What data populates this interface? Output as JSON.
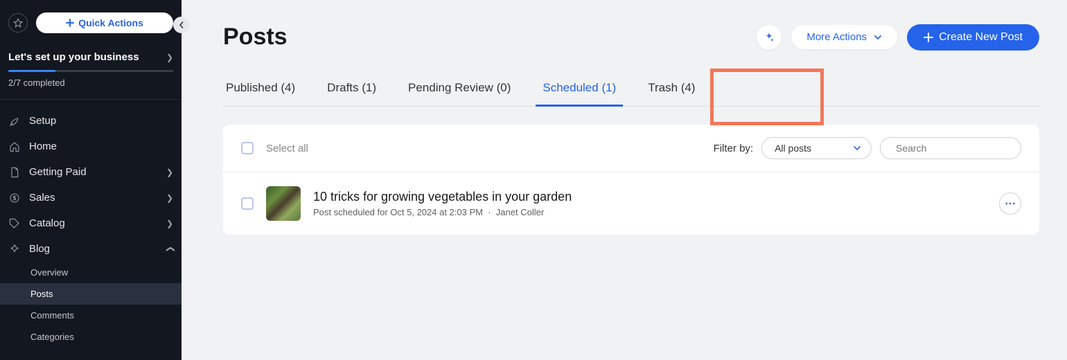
{
  "sidebar": {
    "quick_actions_label": "Quick Actions",
    "setup_title": "Let's set up your business",
    "progress_completed": 2,
    "progress_total": 7,
    "progress_text": "2/7 completed",
    "nav": [
      {
        "label": "Setup",
        "has_chevron": false
      },
      {
        "label": "Home",
        "has_chevron": false
      },
      {
        "label": "Getting Paid",
        "has_chevron": true
      },
      {
        "label": "Sales",
        "has_chevron": true
      },
      {
        "label": "Catalog",
        "has_chevron": true
      },
      {
        "label": "Blog",
        "has_chevron": true,
        "expanded": true
      }
    ],
    "blog_sub": [
      {
        "label": "Overview",
        "active": false
      },
      {
        "label": "Posts",
        "active": true
      },
      {
        "label": "Comments",
        "active": false
      },
      {
        "label": "Categories",
        "active": false
      }
    ]
  },
  "header": {
    "title": "Posts",
    "more_actions_label": "More Actions",
    "create_label": "Create New Post"
  },
  "tabs": [
    {
      "label": "Published (4)",
      "active": false
    },
    {
      "label": "Drafts (1)",
      "active": false
    },
    {
      "label": "Pending Review (0)",
      "active": false
    },
    {
      "label": "Scheduled (1)",
      "active": true
    },
    {
      "label": "Trash (4)",
      "active": false
    }
  ],
  "toolbar": {
    "select_all_label": "Select all",
    "filter_by_label": "Filter by:",
    "filter_value": "All posts",
    "search_placeholder": "Search"
  },
  "posts": [
    {
      "title": "10 tricks for growing vegetables in your garden",
      "meta_schedule": "Post scheduled for Oct 5, 2024 at 2:03 PM",
      "author": "Janet Coller"
    }
  ],
  "colors": {
    "primary": "#2563eb",
    "highlight": "#f4765a",
    "sidebar_bg": "#131720"
  }
}
